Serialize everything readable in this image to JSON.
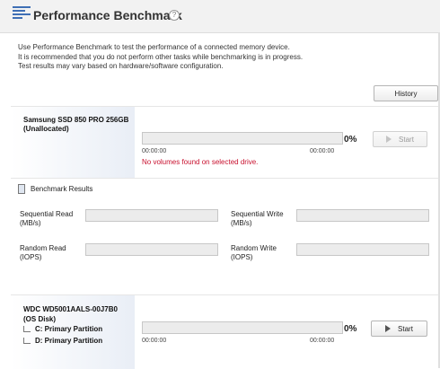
{
  "header": {
    "title": "Performance Benchmark",
    "help_glyph": "?"
  },
  "intro": {
    "lines": [
      "Use Performance Benchmark to test the performance of a connected memory device.",
      "It is recommended that you do not perform other tasks while benchmarking is in progress.",
      "Test results may vary based on hardware/software configuration."
    ]
  },
  "history_button": "History",
  "drives": [
    {
      "name": "Samsung SSD 850 PRO 256GB",
      "subtitle": "(Unallocated)",
      "time_start": "00:00:00",
      "time_end": "00:00:00",
      "progress_percent": 0,
      "percent_label": "0%",
      "start_label": "Start",
      "start_enabled": false,
      "warning": "No volumes found on selected drive."
    },
    {
      "name": "WDC WD5001AALS-00J7B0",
      "subtitle": "(OS Disk)",
      "partitions": [
        "C: Primary Partition",
        "D: Primary Partition"
      ],
      "time_start": "00:00:00",
      "time_end": "00:00:00",
      "progress_percent": 0,
      "percent_label": "0%",
      "start_label": "Start",
      "start_enabled": true
    }
  ],
  "results": {
    "title": "Benchmark Results",
    "metrics": {
      "seq_read": [
        "Sequential Read",
        "(MB/s)"
      ],
      "seq_write": [
        "Sequential Write",
        "(MB/s)"
      ],
      "rand_read": [
        "Random Read",
        "(IOPS)"
      ],
      "rand_write": [
        "Random Write",
        "(IOPS)"
      ]
    },
    "values": {
      "seq_read": "",
      "seq_write": "",
      "rand_read": "",
      "rand_write": ""
    }
  },
  "icons": {
    "header": "benchmark-list-icon",
    "help": "help-icon",
    "results": "clipboard-icon",
    "start": "play-icon",
    "partition": "tree-branch-icon"
  },
  "colors": {
    "accent": "#3f6fb5",
    "warning": "#c8102e"
  }
}
